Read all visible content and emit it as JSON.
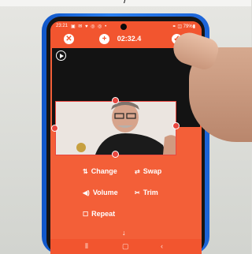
{
  "caption": "/ ",
  "status": {
    "time": "23:21",
    "icons": "▣ ✉ ♥ ◎ ◎ •",
    "right": "⚭ ◫ 79%▮"
  },
  "toolbar": {
    "timer": "02:32.4",
    "close_icon": "✕",
    "add_icon": "+",
    "confirm_icon": "✓"
  },
  "actions": {
    "change": {
      "icon": "⇅",
      "label": "Change"
    },
    "swap": {
      "icon": "⇄",
      "label": "Swap"
    },
    "volume": {
      "icon": "◀)",
      "label": "Volume"
    },
    "trim": {
      "icon": "✂",
      "label": "Trim"
    },
    "repeat": {
      "icon": "☐",
      "label": "Repeat"
    }
  },
  "nav": {
    "down": "↓",
    "recents": "⦀",
    "home": "▢",
    "back": "‹"
  },
  "colors": {
    "accent": "#f2552f",
    "panel": "#f35f38",
    "case": "#1c63d6"
  }
}
